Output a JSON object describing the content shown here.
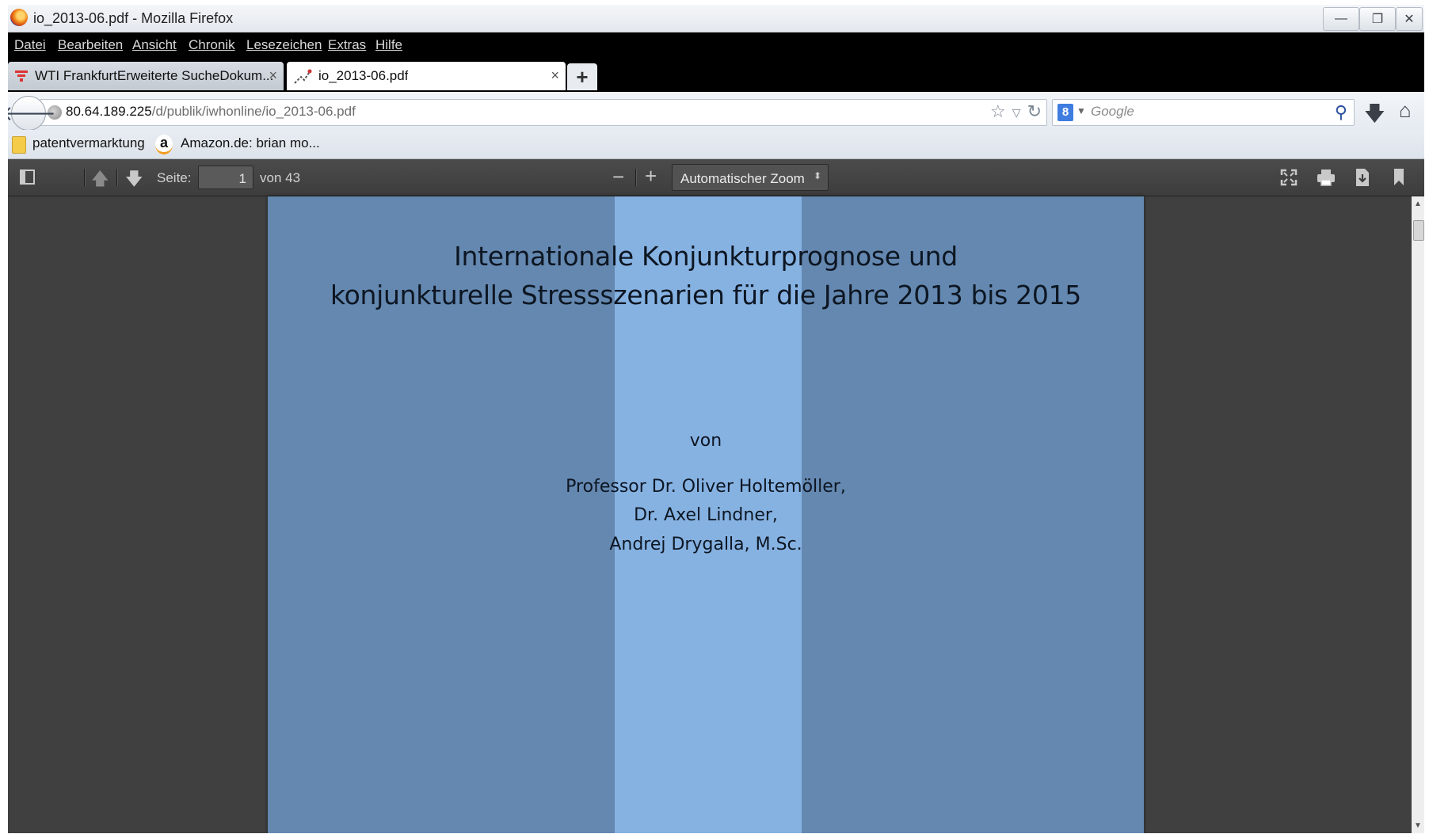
{
  "window": {
    "title": "io_2013-06.pdf - Mozilla Firefox",
    "controls": {
      "minimize": "—",
      "restore": "❐",
      "close": "✕"
    }
  },
  "menu": {
    "items": [
      "Datei",
      "Bearbeiten",
      "Ansicht",
      "Chronik",
      "Lesezeichen",
      "Extras",
      "Hilfe"
    ]
  },
  "tabs": [
    {
      "label": "WTI FrankfurtErweiterte SucheDokum...",
      "close": "×",
      "active": false
    },
    {
      "label": "io_2013-06.pdf",
      "close": "×",
      "active": true
    }
  ],
  "newtab_label": "+",
  "navbar": {
    "url_host": "80.64.189.225",
    "url_path": "/d/publik/iwhonline/io_2013-06.pdf",
    "search_placeholder": "Google",
    "search_engine_badge": "8"
  },
  "bookmarks": [
    {
      "label": "patentvermarktung",
      "icon": "folder-icon"
    },
    {
      "label": "Amazon.de: brian mo...",
      "icon": "amazon-icon"
    }
  ],
  "amazon_glyph": "a",
  "pdf_toolbar": {
    "page_label": "Seite:",
    "page_value": "1",
    "page_total": "von 43",
    "zoom_label": "Automatischer Zoom",
    "zoom_out": "−",
    "zoom_in": "+"
  },
  "document": {
    "title_line1": "Internationale Konjunkturprognose und",
    "title_line2": "konjunkturelle Stressszenarien für die Jahre 2013 bis 2015",
    "by": "von",
    "author1": "Professor Dr. Oliver Holtemöller,",
    "author2": "Dr. Axel Lindner,",
    "author3": "Andrej Drygalla, M.Sc."
  },
  "colors": {
    "page_background": "#6488b0",
    "page_stripe": "#86b2e2",
    "viewer_background": "#404040"
  }
}
